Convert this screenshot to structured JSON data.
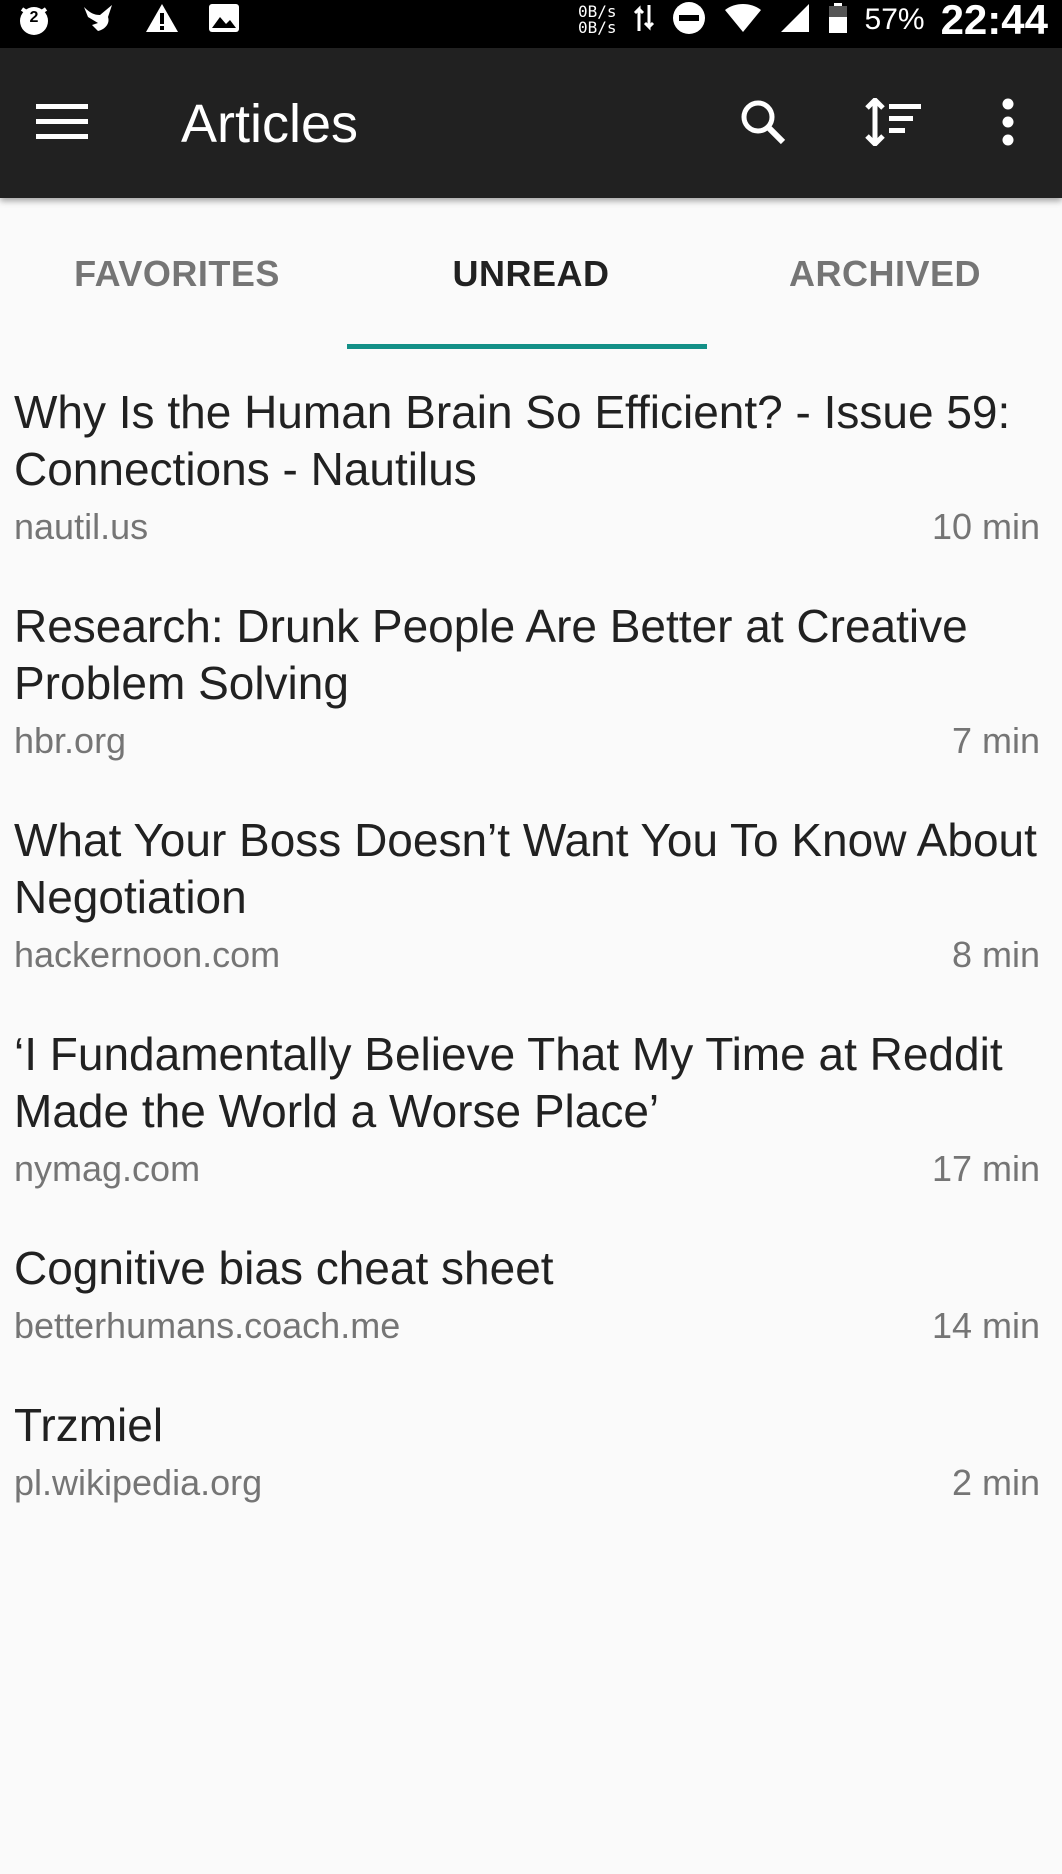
{
  "status_bar": {
    "notif_count": "2",
    "speed_up": "0B/s",
    "speed_down": "0B/s",
    "battery": "57%",
    "time": "22:44"
  },
  "app_bar": {
    "title": "Articles",
    "icons": [
      "menu-icon",
      "search-icon",
      "sort-icon",
      "more-vert-icon"
    ]
  },
  "tabs": [
    {
      "label": "FAVORITES",
      "active": false
    },
    {
      "label": "UNREAD",
      "active": true
    },
    {
      "label": "ARCHIVED",
      "active": false
    }
  ],
  "colors": {
    "app_bar": "#212121",
    "accent": "#139087",
    "background": "#fafafa",
    "secondary_text": "#757575"
  },
  "articles": [
    {
      "title": "Why Is the Human Brain So Efficient? - Issue 59: Connections - Nautilus",
      "domain": "nautil.us",
      "reading_time": "10 min"
    },
    {
      "title": "Research: Drunk People Are Better at Creative Problem Solving",
      "domain": "hbr.org",
      "reading_time": "7 min"
    },
    {
      "title": "What Your Boss Doesn’t Want You To Know About Negotiation",
      "domain": "hackernoon.com",
      "reading_time": "8 min"
    },
    {
      "title": "‘I Fundamentally Believe That My Time at Reddit Made the World a Worse Place’",
      "domain": "nymag.com",
      "reading_time": "17 min"
    },
    {
      "title": "Cognitive bias cheat sheet",
      "domain": "betterhumans.coach.me",
      "reading_time": "14 min"
    },
    {
      "title": "Trzmiel",
      "domain": "pl.wikipedia.org",
      "reading_time": "2 min"
    }
  ]
}
